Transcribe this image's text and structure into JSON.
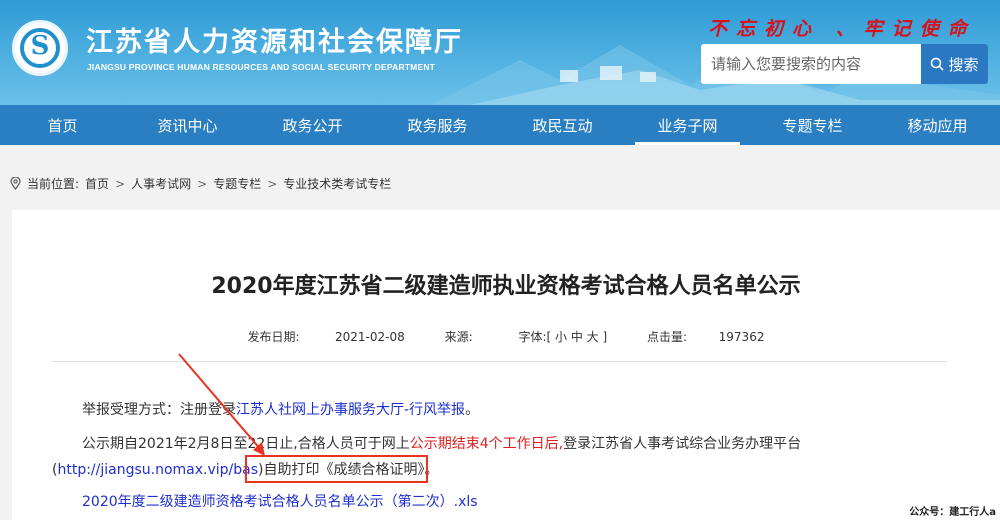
{
  "header": {
    "title": "江苏省人力资源和社会保障厅",
    "subtitle": "JIANGSU PROVINCE HUMAN RESOURCES AND SOCIAL SECURITY DEPARTMENT",
    "slogan": "不忘初心 、牢记使命",
    "search_placeholder": "请输入您要搜索的内容",
    "search_button": "搜索"
  },
  "nav": {
    "items": [
      "首页",
      "资讯中心",
      "政务公开",
      "政务服务",
      "政民互动",
      "业务子网",
      "专题专栏",
      "移动应用"
    ],
    "active_index": 5
  },
  "breadcrumb": {
    "prefix": "当前位置:",
    "items": [
      "首页",
      "人事考试网",
      "专题专栏",
      "专业技术类考试专栏"
    ]
  },
  "article": {
    "title": "2020年度江苏省二级建造师执业资格考试合格人员名单公示",
    "meta": {
      "date_label": "发布日期:",
      "date": "2021-02-08",
      "source_label": "来源:",
      "font_label": "字体:[ 小 中 大 ]",
      "hits_label": "点击量:",
      "hits": "197362"
    },
    "report_prefix": "举报受理方式：注册登录",
    "report_link": "江苏人社网上办事服务大厅-行风举报",
    "report_suffix": "。",
    "notice_part1": "公示期自2021年2月8日至22日止,合格人员可于网上",
    "notice_red": "公示期结束4个工作日后,",
    "notice_part2": "登录江苏省人事考试综合业务办理平台",
    "notice_open": "(",
    "notice_url": "http://jiangsu.nomax.vip/bas",
    "notice_part3": ")自助打印《成绩合格证明》。",
    "attachment": "2020年度二级建造师资格考试合格人员名单公示（第二次）.xls"
  },
  "watermark": "公众号：建工行人a",
  "colors": {
    "nav_bg": "#2a7fc3",
    "header_bg": "#3aa5dc",
    "annotation": "#e83323",
    "link": "#1e2fd0",
    "highlight": "#e02020"
  }
}
